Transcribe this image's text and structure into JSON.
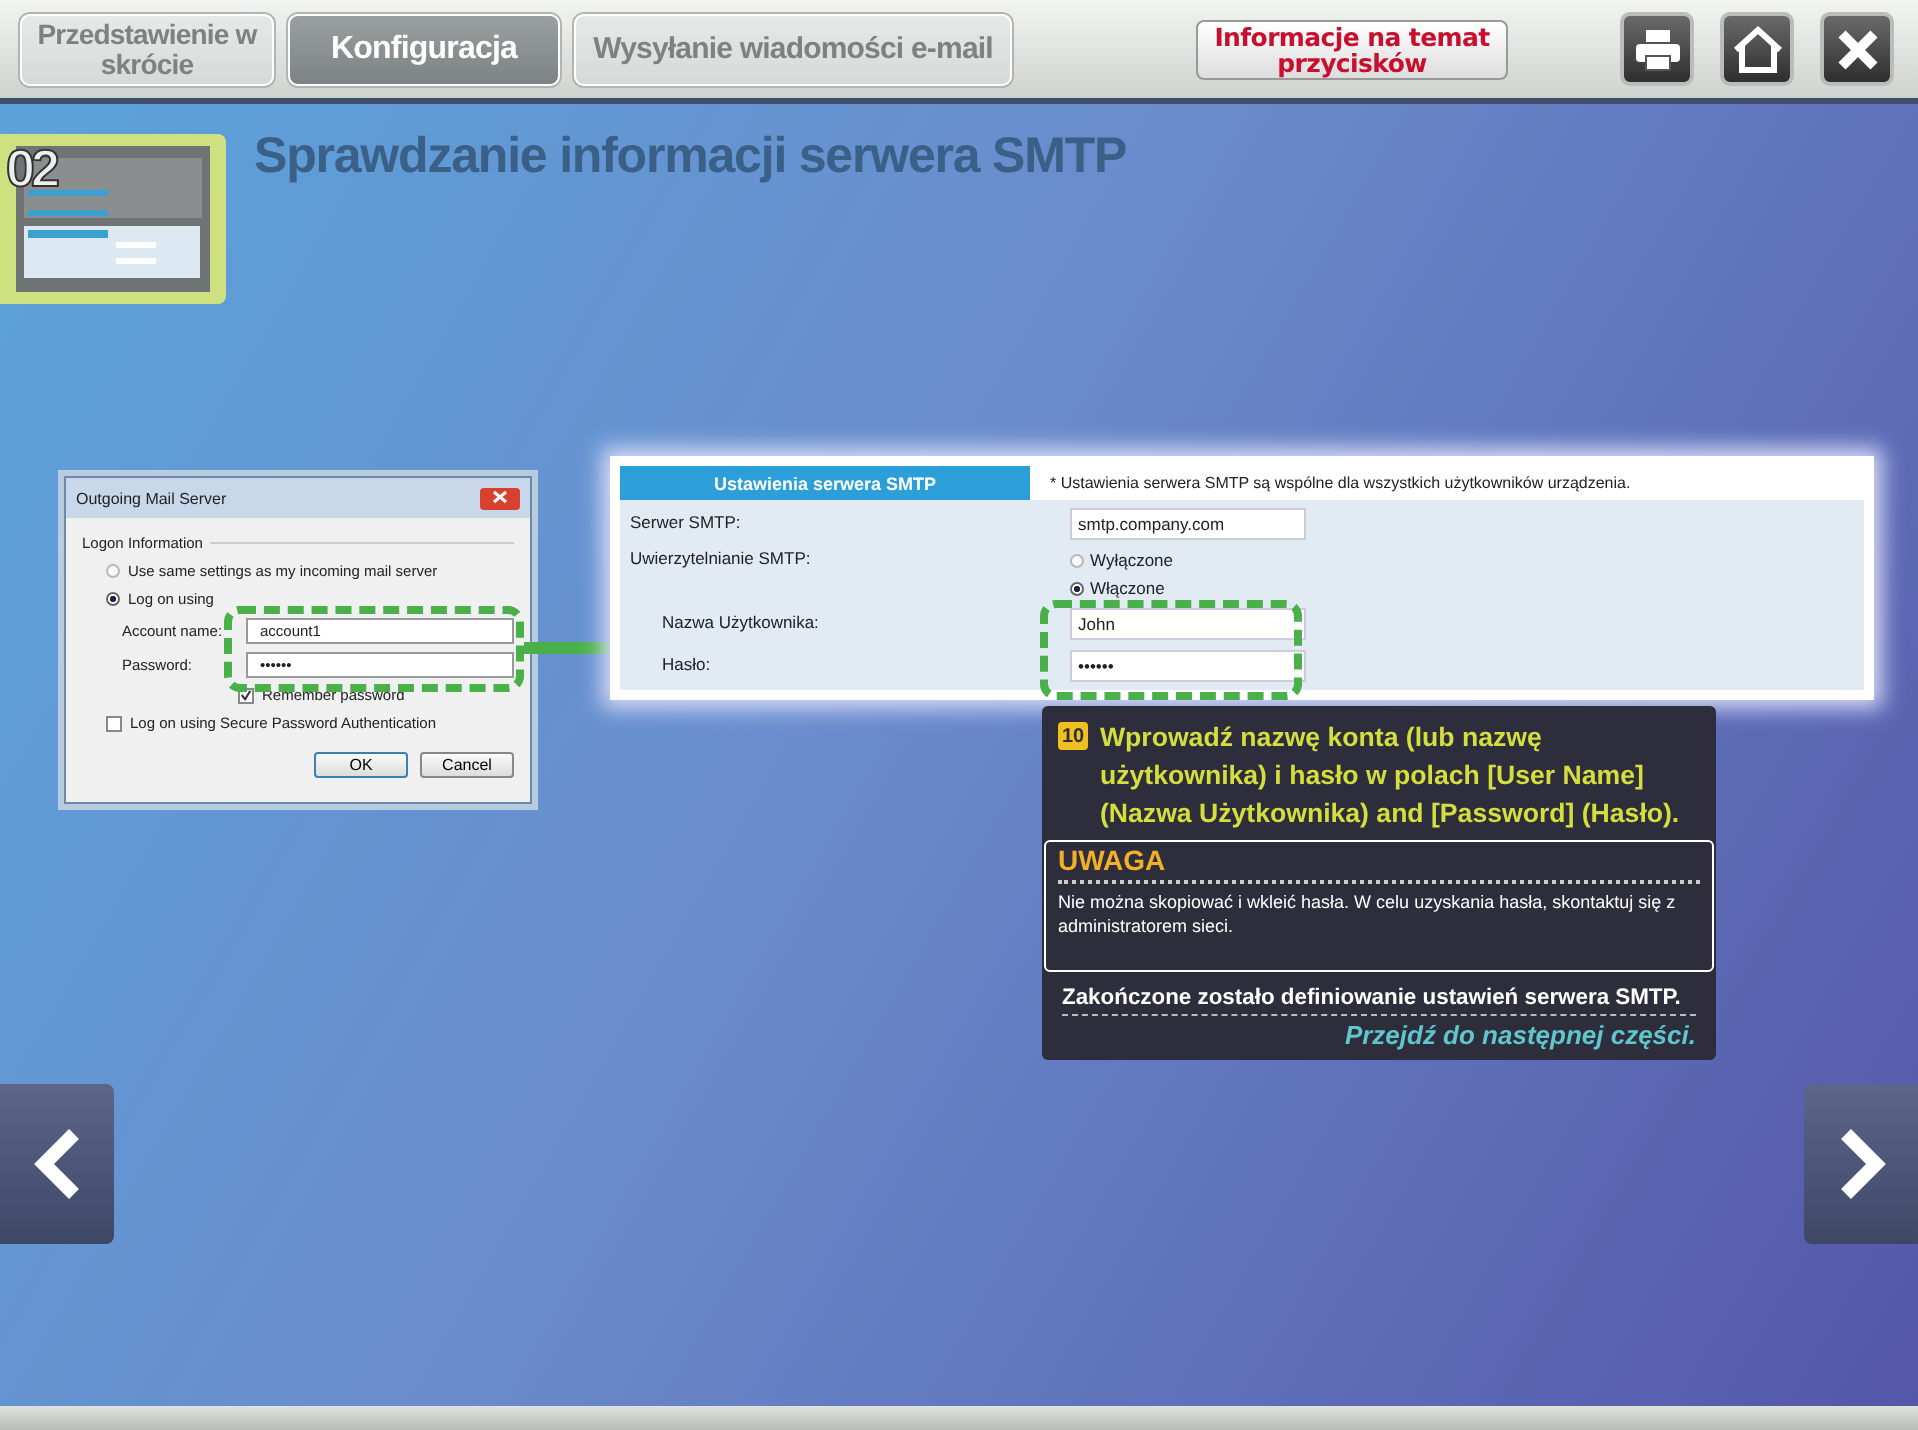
{
  "nav_tabs": [
    {
      "label": "Przedstawienie w skrócie",
      "selected": false
    },
    {
      "label": "Konfiguracja",
      "selected": true
    },
    {
      "label": "Wysyłanie wiadomości e-mail",
      "selected": false
    }
  ],
  "help_button": "Informacje na temat przycisków",
  "step": {
    "number": "02",
    "title": "Sprawdzanie informacji serwera SMTP"
  },
  "dialog": {
    "title": "Outgoing Mail Server",
    "group_label": "Logon Information",
    "options": [
      {
        "label": "Use same settings as my incoming mail server",
        "selected": false
      },
      {
        "label": "Log on using",
        "selected": true
      }
    ],
    "fields": [
      {
        "label": "Account name:",
        "value": "account1"
      },
      {
        "label": "Password:",
        "value": "••••••"
      }
    ],
    "checkboxes": [
      {
        "label": "Remember password",
        "checked": true
      },
      {
        "label": "Log on using Secure Password Authentication",
        "checked": false
      }
    ],
    "buttons": [
      "OK",
      "Cancel"
    ]
  },
  "smtp_panel": {
    "header": "Ustawienia serwera SMTP",
    "note": "* Ustawienia serwera SMTP są wspólne dla wszystkich użytkowników urządzenia.",
    "server": {
      "label": "Serwer SMTP:",
      "value": "smtp.company.com"
    },
    "auth": {
      "label": "Uwierzytelnianie SMTP:",
      "options": [
        {
          "label": "Wyłączone",
          "selected": false
        },
        {
          "label": "Włączone",
          "selected": true
        }
      ]
    },
    "fields": [
      {
        "label": "Nazwa Użytkownika:",
        "value": "John"
      },
      {
        "label": "Hasło:",
        "value": "••••••"
      }
    ]
  },
  "callout": {
    "number": "10",
    "instruction": "Wprowadź nazwę konta (lub nazwę użytkownika) i hasło w polach [User Name] (Nazwa Użytkownika) and [Password] (Hasło).",
    "note_title": "UWAGA",
    "note_text": "Nie można skopiować i wkleić hasła. W celu uzyskania hasła, skontaktuj się z administratorem sieci.",
    "done": "Zakończone zostało definiowanie ustawień serwera SMTP.",
    "next": "Przejdź do następnej części."
  }
}
